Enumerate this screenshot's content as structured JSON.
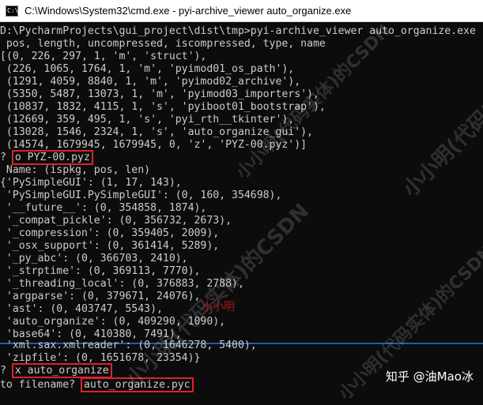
{
  "window": {
    "title": "C:\\Windows\\System32\\cmd.exe - pyi-archive_viewer  auto_organize.exe"
  },
  "console": {
    "lines": [
      "D:\\PycharmProjects\\gui_project\\dist\\tmp>pyi-archive_viewer auto_organize.exe",
      " pos, length, uncompressed, iscompressed, type, name",
      "[(0, 226, 297, 1, 'm', 'struct'),",
      " (226, 1065, 1764, 1, 'm', 'pyimod01_os_path'),",
      " (1291, 4059, 8840, 1, 'm', 'pyimod02_archive'),",
      " (5350, 5487, 13073, 1, 'm', 'pyimod03_importers'),",
      " (10837, 1832, 4115, 1, 's', 'pyiboot01_bootstrap'),",
      " (12669, 359, 495, 1, 's', 'pyi_rth__tkinter'),",
      " (13028, 1546, 2324, 1, 's', 'auto_organize_gui'),",
      " (14574, 1679945, 1679945, 0, 'z', 'PYZ-00.pyz')]",
      "? ",
      " Name: (ispkg, pos, len)",
      "{'PySimpleGUI': (1, 17, 143),",
      " 'PySimpleGUI.PySimpleGUI': (0, 160, 354698),",
      " '__future__': (0, 354858, 1874),",
      " '_compat_pickle': (0, 356732, 2673),",
      " '_compression': (0, 359405, 2009),",
      " '_osx_support': (0, 361414, 5289),",
      " '_py_abc': (0, 366703, 2410),",
      " '_strptime': (0, 369113, 7770),",
      " '_threading_local': (0, 376883, 2788),",
      " 'argparse': (0, 379671, 24076),",
      " 'ast': (0, 403747, 5543),",
      " 'auto_organize': (0, 409290, 1090),",
      " 'base64': (0, 410380, 7491),",
      " 'xml.sax.xmlreader': (0, 1646278, 5400),",
      " 'zipfile': (0, 1651678, 23354)}",
      "",
      "to filename? "
    ],
    "cmd_open": "o PYZ-00.pyz",
    "cmd_extract": "x auto_organize",
    "filename_input": "auto_organize.pyc"
  },
  "watermarks": {
    "text": "小小明(代码实体)的CSDN",
    "short": "小小明"
  },
  "attribution": "知乎 @油Mao冰",
  "colors": {
    "console_bg": "#0c0c0c",
    "console_fg": "#cccccc",
    "highlight_border": "#e0202a"
  }
}
